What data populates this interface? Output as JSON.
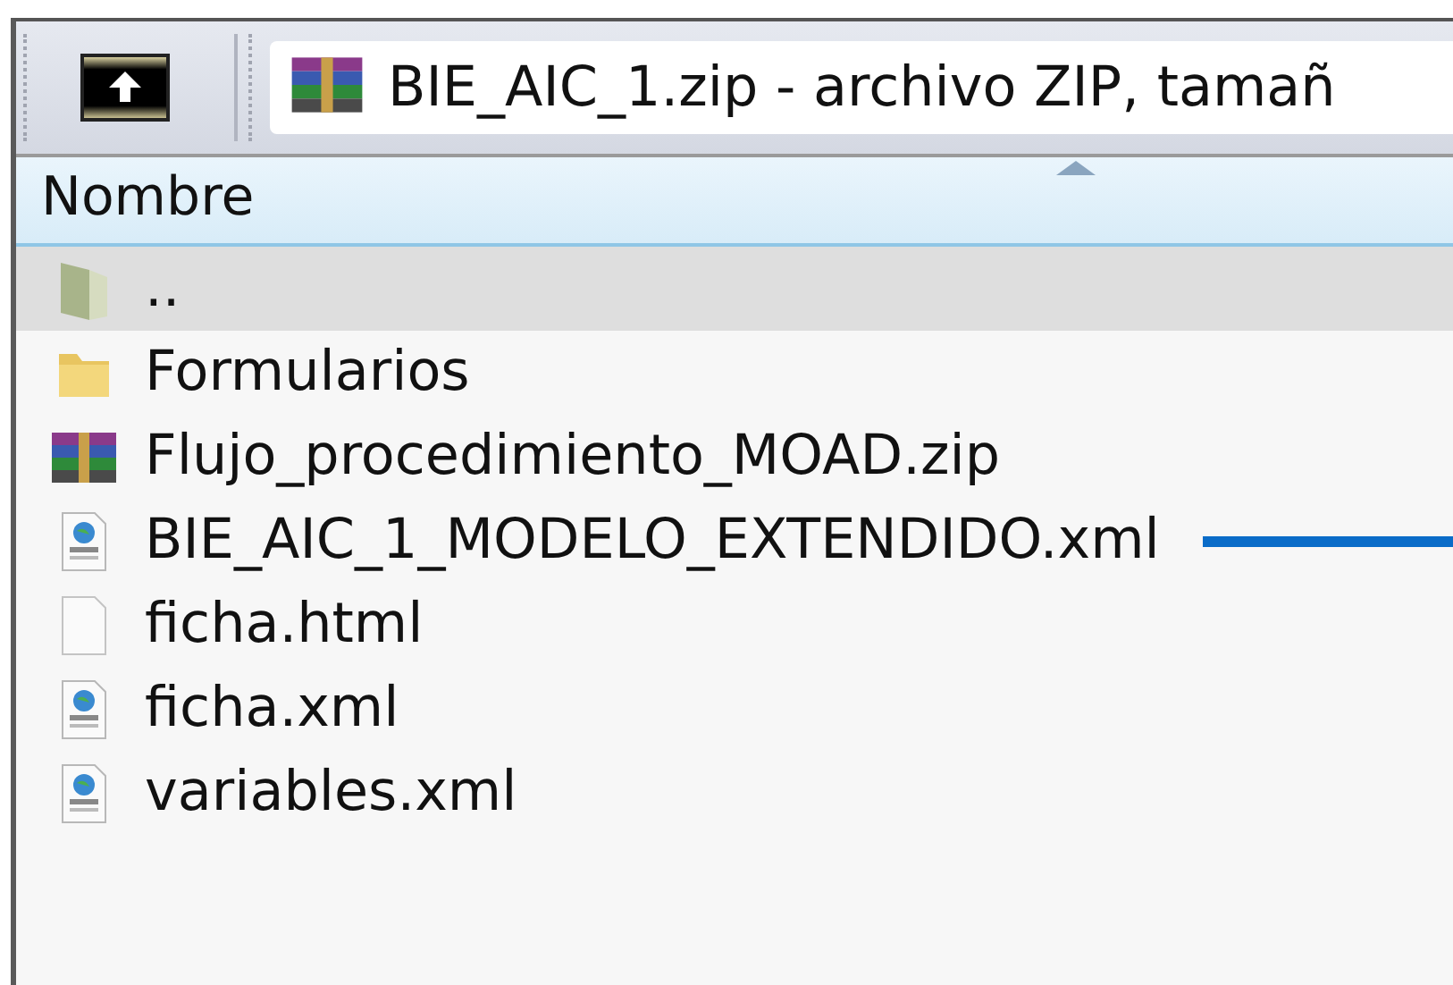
{
  "address": {
    "text": "BIE_AIC_1.zip - archivo ZIP, tamañ"
  },
  "header": {
    "column": "Nombre"
  },
  "files": [
    {
      "name": "..",
      "kind": "parent",
      "selected": true,
      "pointer": false
    },
    {
      "name": "Formularios",
      "kind": "folder",
      "selected": false,
      "pointer": false
    },
    {
      "name": "Flujo_procedimiento_MOAD.zip",
      "kind": "zip",
      "selected": false,
      "pointer": false
    },
    {
      "name": "BIE_AIC_1_MODELO_EXTENDIDO.xml",
      "kind": "xml",
      "selected": false,
      "pointer": true
    },
    {
      "name": "ficha.html",
      "kind": "file",
      "selected": false,
      "pointer": false
    },
    {
      "name": "ficha.xml",
      "kind": "xml",
      "selected": false,
      "pointer": false
    },
    {
      "name": "variables.xml",
      "kind": "xml",
      "selected": false,
      "pointer": false
    }
  ]
}
